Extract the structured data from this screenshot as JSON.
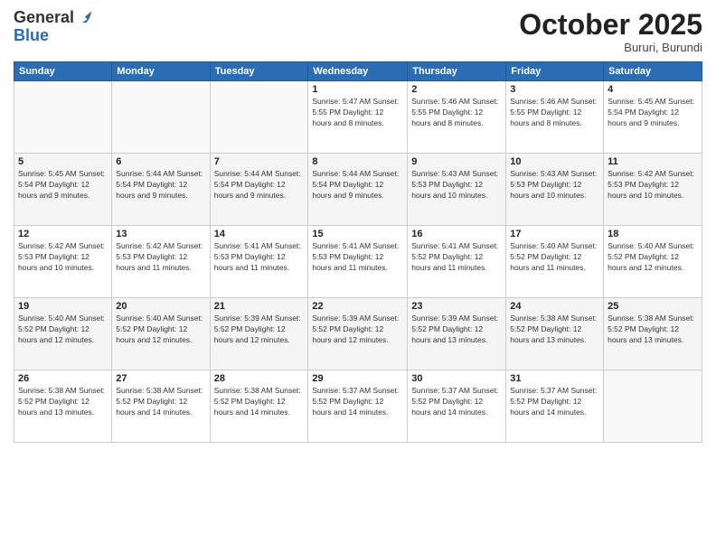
{
  "header": {
    "logo_line1": "General",
    "logo_line2": "Blue",
    "month": "October 2025",
    "location": "Bururi, Burundi"
  },
  "days_of_week": [
    "Sunday",
    "Monday",
    "Tuesday",
    "Wednesday",
    "Thursday",
    "Friday",
    "Saturday"
  ],
  "weeks": [
    [
      {
        "day": "",
        "info": ""
      },
      {
        "day": "",
        "info": ""
      },
      {
        "day": "",
        "info": ""
      },
      {
        "day": "1",
        "info": "Sunrise: 5:47 AM\nSunset: 5:55 PM\nDaylight: 12 hours and 8 minutes."
      },
      {
        "day": "2",
        "info": "Sunrise: 5:46 AM\nSunset: 5:55 PM\nDaylight: 12 hours and 8 minutes."
      },
      {
        "day": "3",
        "info": "Sunrise: 5:46 AM\nSunset: 5:55 PM\nDaylight: 12 hours and 8 minutes."
      },
      {
        "day": "4",
        "info": "Sunrise: 5:45 AM\nSunset: 5:54 PM\nDaylight: 12 hours and 9 minutes."
      }
    ],
    [
      {
        "day": "5",
        "info": "Sunrise: 5:45 AM\nSunset: 5:54 PM\nDaylight: 12 hours and 9 minutes."
      },
      {
        "day": "6",
        "info": "Sunrise: 5:44 AM\nSunset: 5:54 PM\nDaylight: 12 hours and 9 minutes."
      },
      {
        "day": "7",
        "info": "Sunrise: 5:44 AM\nSunset: 5:54 PM\nDaylight: 12 hours and 9 minutes."
      },
      {
        "day": "8",
        "info": "Sunrise: 5:44 AM\nSunset: 5:54 PM\nDaylight: 12 hours and 9 minutes."
      },
      {
        "day": "9",
        "info": "Sunrise: 5:43 AM\nSunset: 5:53 PM\nDaylight: 12 hours and 10 minutes."
      },
      {
        "day": "10",
        "info": "Sunrise: 5:43 AM\nSunset: 5:53 PM\nDaylight: 12 hours and 10 minutes."
      },
      {
        "day": "11",
        "info": "Sunrise: 5:42 AM\nSunset: 5:53 PM\nDaylight: 12 hours and 10 minutes."
      }
    ],
    [
      {
        "day": "12",
        "info": "Sunrise: 5:42 AM\nSunset: 5:53 PM\nDaylight: 12 hours and 10 minutes."
      },
      {
        "day": "13",
        "info": "Sunrise: 5:42 AM\nSunset: 5:53 PM\nDaylight: 12 hours and 11 minutes."
      },
      {
        "day": "14",
        "info": "Sunrise: 5:41 AM\nSunset: 5:53 PM\nDaylight: 12 hours and 11 minutes."
      },
      {
        "day": "15",
        "info": "Sunrise: 5:41 AM\nSunset: 5:53 PM\nDaylight: 12 hours and 11 minutes."
      },
      {
        "day": "16",
        "info": "Sunrise: 5:41 AM\nSunset: 5:52 PM\nDaylight: 12 hours and 11 minutes."
      },
      {
        "day": "17",
        "info": "Sunrise: 5:40 AM\nSunset: 5:52 PM\nDaylight: 12 hours and 11 minutes."
      },
      {
        "day": "18",
        "info": "Sunrise: 5:40 AM\nSunset: 5:52 PM\nDaylight: 12 hours and 12 minutes."
      }
    ],
    [
      {
        "day": "19",
        "info": "Sunrise: 5:40 AM\nSunset: 5:52 PM\nDaylight: 12 hours and 12 minutes."
      },
      {
        "day": "20",
        "info": "Sunrise: 5:40 AM\nSunset: 5:52 PM\nDaylight: 12 hours and 12 minutes."
      },
      {
        "day": "21",
        "info": "Sunrise: 5:39 AM\nSunset: 5:52 PM\nDaylight: 12 hours and 12 minutes."
      },
      {
        "day": "22",
        "info": "Sunrise: 5:39 AM\nSunset: 5:52 PM\nDaylight: 12 hours and 12 minutes."
      },
      {
        "day": "23",
        "info": "Sunrise: 5:39 AM\nSunset: 5:52 PM\nDaylight: 12 hours and 13 minutes."
      },
      {
        "day": "24",
        "info": "Sunrise: 5:38 AM\nSunset: 5:52 PM\nDaylight: 12 hours and 13 minutes."
      },
      {
        "day": "25",
        "info": "Sunrise: 5:38 AM\nSunset: 5:52 PM\nDaylight: 12 hours and 13 minutes."
      }
    ],
    [
      {
        "day": "26",
        "info": "Sunrise: 5:38 AM\nSunset: 5:52 PM\nDaylight: 12 hours and 13 minutes."
      },
      {
        "day": "27",
        "info": "Sunrise: 5:38 AM\nSunset: 5:52 PM\nDaylight: 12 hours and 14 minutes."
      },
      {
        "day": "28",
        "info": "Sunrise: 5:38 AM\nSunset: 5:52 PM\nDaylight: 12 hours and 14 minutes."
      },
      {
        "day": "29",
        "info": "Sunrise: 5:37 AM\nSunset: 5:52 PM\nDaylight: 12 hours and 14 minutes."
      },
      {
        "day": "30",
        "info": "Sunrise: 5:37 AM\nSunset: 5:52 PM\nDaylight: 12 hours and 14 minutes."
      },
      {
        "day": "31",
        "info": "Sunrise: 5:37 AM\nSunset: 5:52 PM\nDaylight: 12 hours and 14 minutes."
      },
      {
        "day": "",
        "info": ""
      }
    ]
  ]
}
